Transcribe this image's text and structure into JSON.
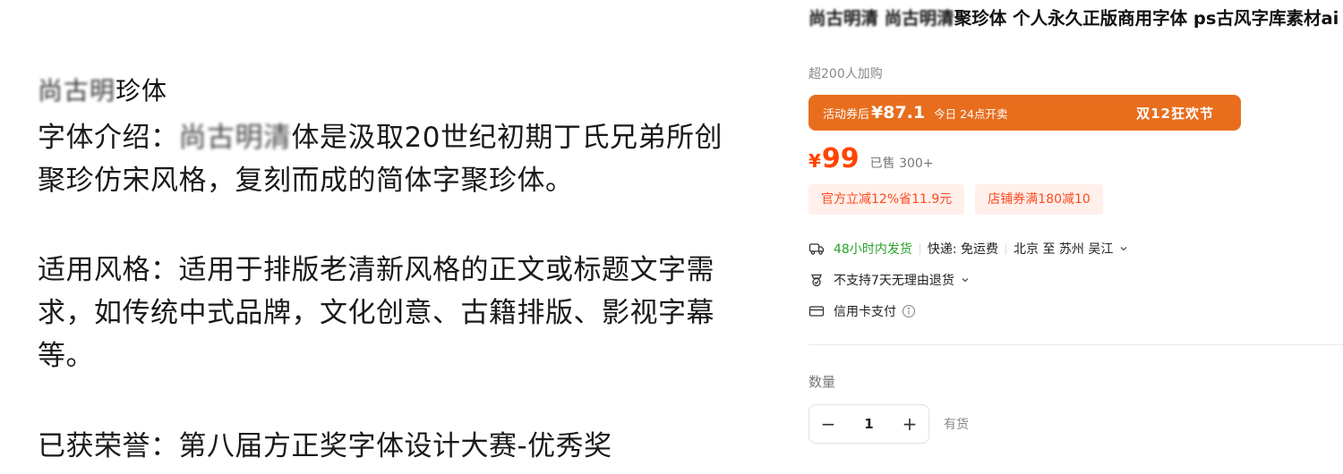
{
  "description": {
    "title": {
      "blurred": "尚古明",
      "rest": "珍体"
    },
    "intro": {
      "label": "字体介绍：",
      "blurred": "尚古明清",
      "text": "体是汲取20世纪初期丁氏兄弟所创聚珍仿宋风格，复刻而成的简体字聚珍体。"
    },
    "style": "适用风格：适用于排版老清新风格的正文或标题文字需求，如传统中式品牌，文化创意、古籍排版、影视字幕等。",
    "honor": "已获荣誉：第八届方正奖字体设计大赛-优秀奖"
  },
  "product": {
    "title_blurred": "尚古明清 尚古明清",
    "title_text": "聚珍体 个人永久正版商用字体 ps古风字库素材ai",
    "buyers": "超200人加购",
    "promo": {
      "label": "活动券后",
      "price": "¥87.1",
      "time": "今日 24点开卖",
      "festival": "双12狂欢节",
      "color": "#e86e1e"
    },
    "price": {
      "symbol": "¥",
      "value": "99",
      "sold": "已售 300+",
      "color": "#ff4400"
    },
    "tags": [
      "官方立减12%省11.9元",
      "店铺券满180减10"
    ],
    "shipping": {
      "time": "48小时内发货",
      "fee": "快递: 免运费",
      "route": "北京 至 苏州 吴江",
      "icon": "truck-icon"
    },
    "returns": {
      "text": "不支持7天无理由退货",
      "icon": "return-icon"
    },
    "payment": {
      "text": "信用卡支付",
      "icon": "credit-card-icon"
    },
    "quantity": {
      "label": "数量",
      "value": "1",
      "minus": "−",
      "plus": "+",
      "stock": "有货"
    }
  }
}
